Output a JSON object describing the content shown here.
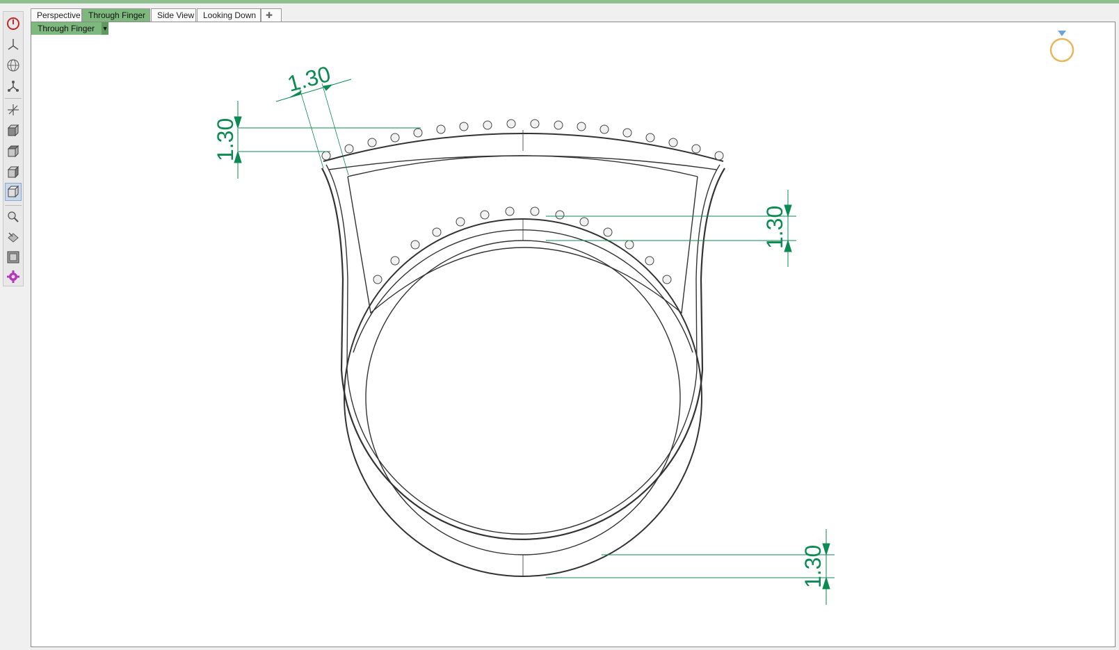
{
  "tabs": [
    {
      "label": "Perspective",
      "active": false
    },
    {
      "label": "Through Finger",
      "active": true
    },
    {
      "label": "Side View",
      "active": false
    },
    {
      "label": "Looking Down",
      "active": false
    }
  ],
  "viewport": {
    "label": "Through Finger",
    "dimensions": [
      {
        "name": "top-left-vertical",
        "text": "1.30"
      },
      {
        "name": "top-left-diagonal",
        "text": "1.30"
      },
      {
        "name": "right-middle",
        "text": "1.30"
      },
      {
        "name": "bottom-right",
        "text": "1.30"
      }
    ]
  },
  "toolbar": {
    "tools": [
      "power-icon",
      "views-icon",
      "globe-icon",
      "connect-icon",
      "axes-icon",
      "cube-front-icon",
      "cube-top-icon",
      "cube-side-icon",
      "cube-iso-icon",
      "magnify-tool-icon",
      "render-tool-icon",
      "zoom-extents-icon",
      "gem-settings-icon"
    ]
  },
  "colors": {
    "accent": "#7db87d",
    "dimension": "#0b8a52",
    "outline": "#333333"
  }
}
